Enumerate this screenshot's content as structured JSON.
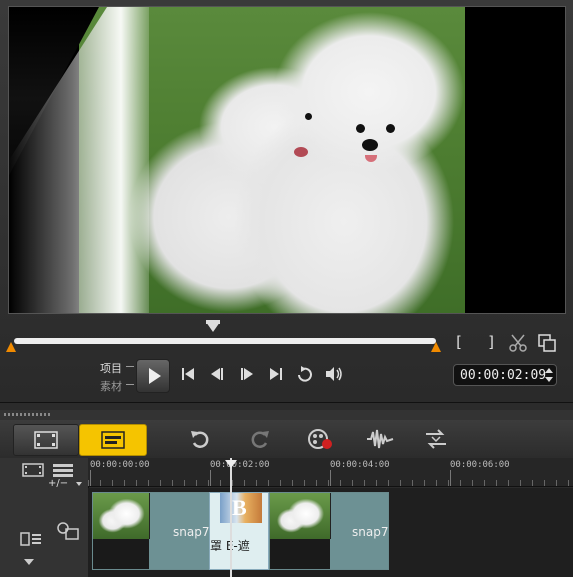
{
  "preview": {
    "mode_project": "项目",
    "mode_clip": "素材",
    "mark_in": "[",
    "mark_out": "]",
    "timecode": "00:00:02:09"
  },
  "timeline": {
    "ruler": [
      "00:00:00:00",
      "00:00:02:00",
      "00:00:04:00",
      "00:00:06:00"
    ],
    "add_remove": "+/−",
    "clips": [
      {
        "label": "snap7"
      },
      {
        "label": "snap7"
      }
    ],
    "transition": {
      "badge": "B",
      "label": "罩 E-遮"
    }
  },
  "colors": {
    "accent": "#f5c400",
    "trim": "#f08a00"
  }
}
